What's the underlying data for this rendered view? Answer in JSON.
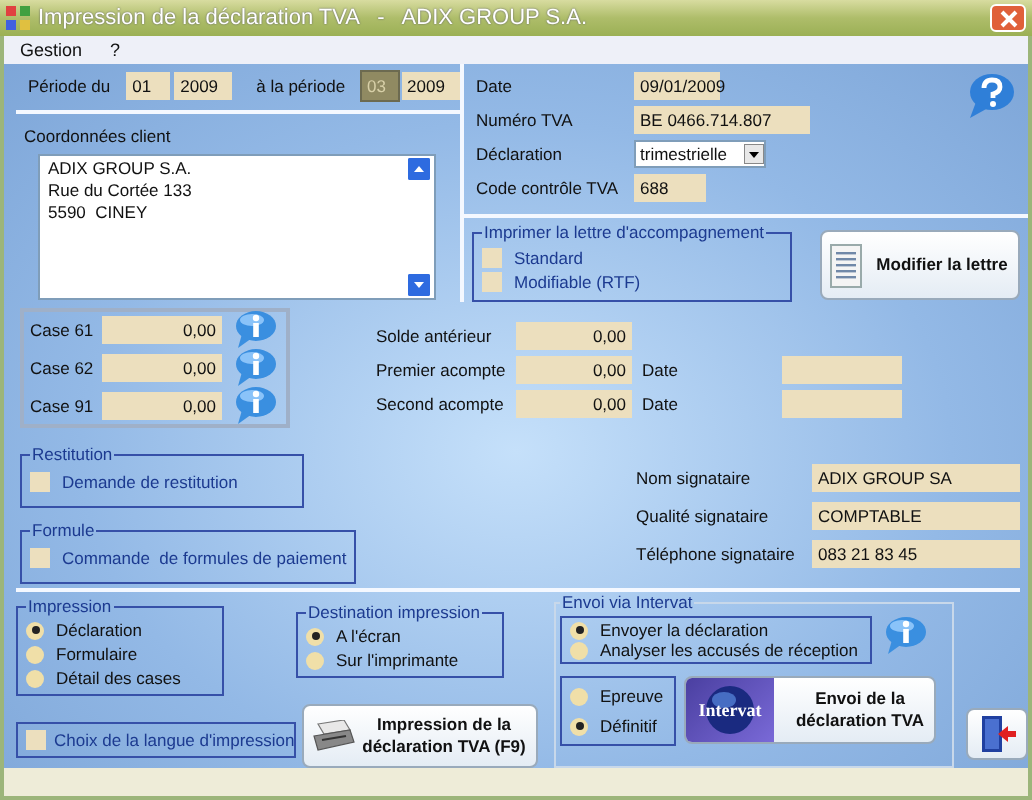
{
  "window": {
    "title": "Impression de la déclaration TVA   -   ADIX GROUP S.A."
  },
  "menu": [
    "Gestion",
    "?"
  ],
  "period": {
    "from_label": "Période du",
    "from_month": "01",
    "from_year": "2009",
    "to_label": "à la période",
    "to_month": "03",
    "to_month_focused": true,
    "to_year": "2009"
  },
  "client": {
    "label": "Coordonnées client",
    "lines": [
      "ADIX GROUP S.A.",
      "Rue du Cortée 133",
      "5590  CINEY"
    ]
  },
  "info_fields": [
    {
      "label": "Date",
      "value": "09/01/2009",
      "kind": "short"
    },
    {
      "label": "Numéro TVA",
      "value": "BE 0466.714.807",
      "kind": "long"
    },
    {
      "label": "Déclaration",
      "value": "trimestrielle",
      "kind": "select"
    },
    {
      "label": "Code contrôle TVA",
      "value": "688",
      "kind": "tiny"
    }
  ],
  "letter": {
    "title": "Imprimer la lettre d'accompagnement",
    "options": [
      {
        "label": "Standard",
        "checked": false
      },
      {
        "label": "Modifiable (RTF)",
        "checked": false
      }
    ],
    "button": "Modifier la lettre"
  },
  "cases": [
    {
      "label": "Case 61",
      "value": "0,00"
    },
    {
      "label": "Case 62",
      "value": "0,00"
    },
    {
      "label": "Case 91",
      "value": "0,00"
    }
  ],
  "balances": [
    {
      "label": "Solde antérieur",
      "value": "0,00"
    },
    {
      "label": "Premier acompte",
      "value": "0,00",
      "date_label": "Date"
    },
    {
      "label": "Second acompte",
      "value": "0,00",
      "date_label": "Date"
    }
  ],
  "restitution": {
    "title": "Restitution",
    "label": "Demande de restitution",
    "checked": false
  },
  "formule": {
    "title": "Formule",
    "label": "Commande  de formules de paiement",
    "checked": false
  },
  "signatory": [
    {
      "label": "Nom signataire",
      "value": "ADIX GROUP SA"
    },
    {
      "label": "Qualité signataire",
      "value": "COMPTABLE"
    },
    {
      "label": "Téléphone signataire",
      "value": "083 21 83 45"
    }
  ],
  "impression": {
    "title": "Impression",
    "options": [
      {
        "label": "Déclaration",
        "selected": true
      },
      {
        "label": "Formulaire",
        "selected": false
      },
      {
        "label": "Détail des cases",
        "selected": false
      }
    ]
  },
  "destination": {
    "title": "Destination impression",
    "options": [
      {
        "label": "A l'écran",
        "selected": true
      },
      {
        "label": "Sur l'imprimante",
        "selected": false
      }
    ]
  },
  "language_choice": {
    "label": "Choix de la langue d'impression",
    "checked": false
  },
  "print_button": {
    "line1": "Impression de la",
    "line2": "déclaration TVA (F9)"
  },
  "intervat": {
    "title": "Envoi via Intervat",
    "actions": [
      {
        "label": "Envoyer la déclaration",
        "selected": true
      },
      {
        "label": "Analyser les accusés de réception",
        "selected": false
      }
    ],
    "modes": [
      {
        "label": "Epreuve",
        "selected": false
      },
      {
        "label": "Définitif",
        "selected": true
      }
    ],
    "logo": "Intervat",
    "button": {
      "line1": "Envoi de la",
      "line2": "déclaration TVA"
    }
  }
}
